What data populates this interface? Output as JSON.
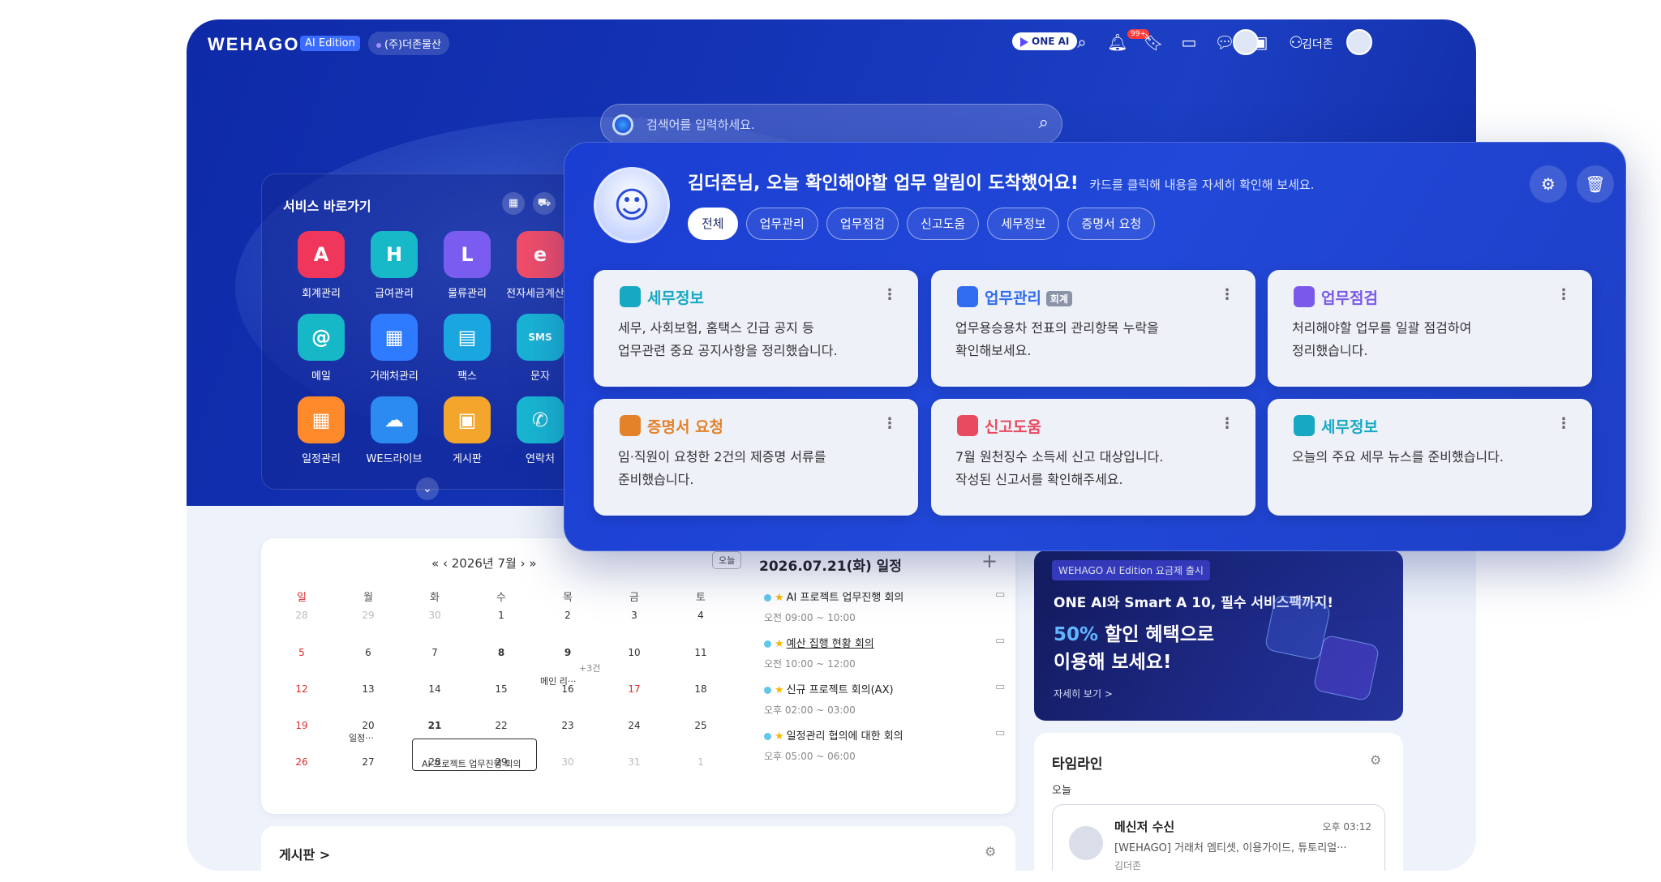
{
  "topbar": {
    "logo": "WEHAGO",
    "edition": "AI Edition",
    "company": "(주)더존물산",
    "oneai": "ONE AI",
    "notif_badge": "99+",
    "user_name": "김더존"
  },
  "search": {
    "placeholder": "검색어를 입력하세요."
  },
  "services": {
    "title": "서비스 바로가기",
    "apps": [
      {
        "label": "회계관리",
        "icon": "A",
        "color": "#f0365a"
      },
      {
        "label": "급여관리",
        "icon": "H",
        "color": "#17b9c9"
      },
      {
        "label": "물류관리",
        "icon": "L",
        "color": "#7b5cf0"
      },
      {
        "label": "전자세금계산서",
        "icon": "e",
        "color": "#f04d6a"
      },
      {
        "label": "메일",
        "icon": "@",
        "color": "#16b8c8"
      },
      {
        "label": "거래처관리",
        "icon": "▦",
        "color": "#2f7bff"
      },
      {
        "label": "팩스",
        "icon": "▤",
        "color": "#1aa7e0"
      },
      {
        "label": "문자",
        "icon": "SMS",
        "color": "#19b4d6"
      },
      {
        "label": "일정관리",
        "icon": "▦",
        "color": "#ff8a2b"
      },
      {
        "label": "WE드라이브",
        "icon": "☁",
        "color": "#2b8bf0"
      },
      {
        "label": "게시판",
        "icon": "▣",
        "color": "#f3a52c"
      },
      {
        "label": "연락처",
        "icon": "✆",
        "color": "#18b7d2"
      }
    ]
  },
  "notification": {
    "heading": "김더존님, 오늘 확인해야할 업무 알림이 도착했어요!",
    "sub": "카드를 클릭해 내용을 자세히 확인해 보세요.",
    "chips": [
      "전체",
      "업무관리",
      "업무점검",
      "신고도움",
      "세무정보",
      "증명서 요청"
    ],
    "cards": [
      {
        "title": "세무정보",
        "color": "#17a8c4",
        "tag": "",
        "line1": "세무, 사회보험, 홈택스 긴급 공지 등",
        "line2": "업무관련 중요 공지사항을 정리했습니다."
      },
      {
        "title": "업무관리",
        "color": "#2f6cf0",
        "tag": "회계",
        "line1": "업무용승용차 전표의 관리항목 누락을",
        "line2": "확인해보세요."
      },
      {
        "title": "업무점검",
        "color": "#7a58ea",
        "tag": "",
        "line1": "처리해야할 업무를 일괄 점검하여",
        "line2": "정리했습니다."
      },
      {
        "title": "증명서 요청",
        "color": "#e4822a",
        "tag": "",
        "line1": "임·직원이 요청한 2건의 제증명 서류를",
        "line2": "준비했습니다."
      },
      {
        "title": "신고도움",
        "color": "#e84a5f",
        "tag": "",
        "line1": "7월 원천징수 소득세 신고 대상입니다.",
        "line2": "작성된 신고서를 확인해주세요."
      },
      {
        "title": "세무정보",
        "color": "#17a8c4",
        "tag": "",
        "line1": "오늘의 주요 세무 뉴스를 준비했습니다.",
        "line2": ""
      }
    ]
  },
  "calendar": {
    "month": "2026년 7월",
    "today_label": "오늘",
    "weekdays": [
      "일",
      "월",
      "화",
      "수",
      "목",
      "금",
      "토"
    ],
    "weeks": [
      [
        "28",
        "29",
        "30",
        "1",
        "2",
        "3",
        "4"
      ],
      [
        "5",
        "6",
        "7",
        "8",
        "9",
        "10",
        "11"
      ],
      [
        "12",
        "13",
        "14",
        "15",
        "16",
        "17",
        "18"
      ],
      [
        "19",
        "20",
        "21",
        "22",
        "23",
        "24",
        "25"
      ],
      [
        "26",
        "27",
        "28",
        "29",
        "30",
        "31",
        "1"
      ]
    ],
    "events": {
      "more": "+3건",
      "e1": "메인 리···",
      "e2": "일정···",
      "e3": "AI 프로젝트 업무진행 회의"
    }
  },
  "schedule": {
    "title": "2026.07.21(화) 일정",
    "items": [
      {
        "title": "AI 프로젝트 업무진행 회의",
        "time": "오전 09:00 ~ 10:00"
      },
      {
        "title": "예산 집행 현황 회의",
        "time": "오전 10:00 ~ 12:00"
      },
      {
        "title": "신규 프로젝트 회의(AX)",
        "time": "오후 02:00 ~ 03:00"
      },
      {
        "title": "일정관리 협의에 대한 회의",
        "time": "오후 05:00 ~ 06:00"
      }
    ]
  },
  "board": {
    "title": "게시판 >"
  },
  "promo": {
    "tag": "WEHAGO AI Edition 요금제 출시",
    "line1": "ONE AI와 Smart A 10, 필수 서비스팩까지!",
    "highlight": "50%",
    "line2": " 할인 혜택으로",
    "line3": "이용해 보세요!",
    "more": "자세히 보기 >"
  },
  "timeline": {
    "title": "타임라인",
    "today": "오늘",
    "item": {
      "name": "메신저 수신",
      "time": "오후 03:12",
      "message": "[WEHAGO] 거래처 엠티셋, 이용가이드, 튜토리얼···",
      "from": "김더존"
    }
  }
}
